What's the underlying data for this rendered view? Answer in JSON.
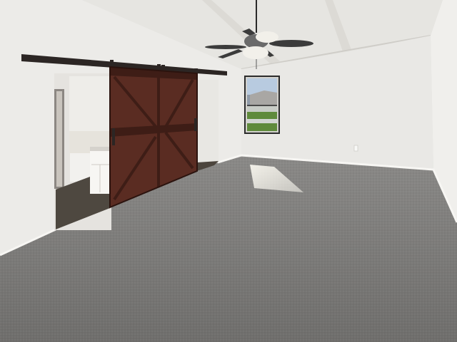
{
  "scene": {
    "kind": "interior-photo-empty-room",
    "colors": {
      "ceiling": "#e6e5e1",
      "beam": "#dcdad5",
      "wall_left": "#ecebe8",
      "wall_back": "#e9e8e5",
      "wall_right": "#f0efec",
      "carpet": "#8a8987",
      "carpet_dark": "#6f6e6c",
      "barn_door": "#5a2c22",
      "barn_door_dark": "#3e1d16",
      "rail": "#2c2624",
      "window_sky": "#b8cbe0",
      "window_grass": "#5f8a3c",
      "bathroom_floor": "#4e4840",
      "fan_blade": "#3b3b3b",
      "fan_body": "#f2f0ea",
      "baseboard": "#f7f6f3",
      "sunlight": "#f8f6ee"
    }
  }
}
